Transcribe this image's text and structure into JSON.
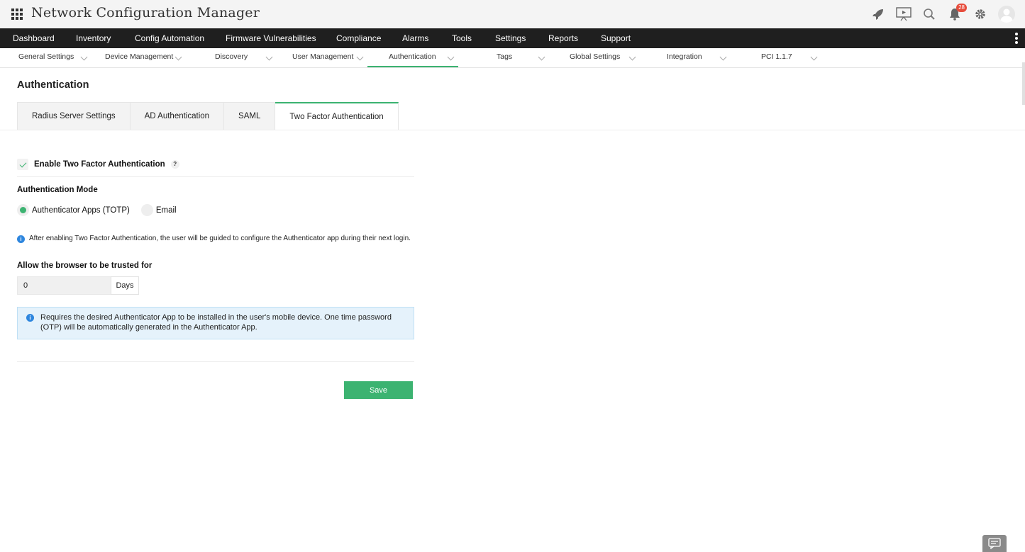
{
  "app": {
    "title": "Network Configuration Manager",
    "notification_count": "28"
  },
  "main_nav": [
    "Dashboard",
    "Inventory",
    "Config Automation",
    "Firmware Vulnerabilities",
    "Compliance",
    "Alarms",
    "Tools",
    "Settings",
    "Reports",
    "Support"
  ],
  "sub_nav": [
    "General Settings",
    "Device Management",
    "Discovery",
    "User Management",
    "Authentication",
    "Tags",
    "Global Settings",
    "Integration",
    "PCI 1.1.7"
  ],
  "sub_nav_active": "Authentication",
  "page": {
    "title": "Authentication"
  },
  "tabs": [
    "Radius Server Settings",
    "AD Authentication",
    "SAML",
    "Two Factor Authentication"
  ],
  "active_tab": "Two Factor Authentication",
  "form": {
    "enable_label": "Enable Two Factor Authentication",
    "enable_checked": true,
    "help_glyph": "?",
    "mode_label": "Authentication Mode",
    "mode_options": [
      "Authenticator Apps (TOTP)",
      "Email"
    ],
    "mode_selected": "Authenticator Apps (TOTP)",
    "note": "After enabling Two Factor Authentication, the user will be guided to configure the Authenticator app during their next login.",
    "trust_label": "Allow the browser to be trusted for",
    "trust_value": "0",
    "trust_unit": "Days",
    "info": "Requires the desired Authenticator App to be installed in the user's mobile device. One time password (OTP) will be automatically generated in the Authenticator App.",
    "save_label": "Save"
  },
  "colors": {
    "accent": "#3cb371",
    "nav_bg": "#1f1f1f",
    "info_bg": "#e5f2fb",
    "info_icon": "#2e86de",
    "badge": "#e74c3c"
  },
  "icons": [
    "app-grid-icon",
    "rocket-icon",
    "presentation-icon",
    "search-icon",
    "bell-icon",
    "gear-icon",
    "user-avatar-icon",
    "kebab-menu-icon",
    "chat-icon"
  ]
}
